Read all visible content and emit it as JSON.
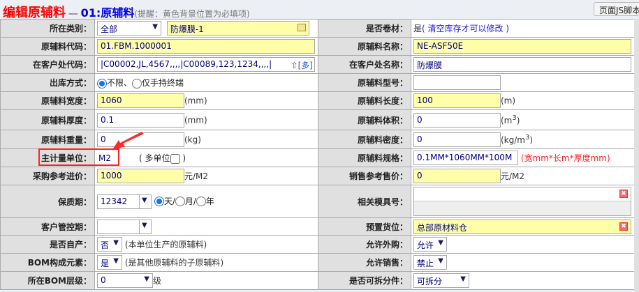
{
  "header": {
    "title": "编辑原辅料",
    "dash": "—",
    "subtitle": "01:原辅料",
    "hint": "(提醒：黄色背景位置为必填项)",
    "js_button": "页面JS脚本"
  },
  "colors": {
    "required": "#ffffaa",
    "title": "#ff0000",
    "subtitle": "#0000ee",
    "annotation": "#ff2222"
  },
  "fields": {
    "category": {
      "label": "所在类别：",
      "select": "全部",
      "value": "防爆膜-1"
    },
    "is_roll": {
      "label": "是否卷材：",
      "value": "是",
      "note": "( 清空库存才可以修改 )"
    },
    "code": {
      "label": "原辅料代码：",
      "value": "01.FBM.1000001"
    },
    "name": {
      "label": "原辅料名称：",
      "value": "NE-ASF50E"
    },
    "cust_code": {
      "label": "在客户处代码：",
      "value": "|C00002,JL,4567,,,,|C00089,123,1234,,,,|",
      "more": "[多]"
    },
    "cust_name": {
      "label": "在客户处名称：",
      "value": "防爆膜"
    },
    "outbound": {
      "label": "出库方式：",
      "opt1": "不限、",
      "opt2": "仅手持终端"
    },
    "model": {
      "label": "原辅料型号：",
      "value": ""
    },
    "width": {
      "label": "原辅料宽度：",
      "value": "1060",
      "unit": "(mm)"
    },
    "length": {
      "label": "原辅料长度：",
      "value": "100",
      "unit": "(m)"
    },
    "thickness": {
      "label": "原辅料厚度：",
      "value": "0.1",
      "unit": "(mm)"
    },
    "volume": {
      "label": "原辅料体积：",
      "value": "0",
      "unit": "(m",
      "sup": "3",
      "unit_end": ")"
    },
    "weight": {
      "label": "原辅料重量：",
      "value": "0",
      "unit": "(kg)"
    },
    "density": {
      "label": "原辅料密度：",
      "value": "0",
      "unit": "(kg/m",
      "sup": "3",
      "unit_end": ")"
    },
    "main_unit": {
      "label": "主计量单位：",
      "value": "M2",
      "multi": "( 多单位",
      "multi_end": ")"
    },
    "spec": {
      "label": "原辅料规格：",
      "value": "0.1MM*1060MM*100M",
      "note": "(宽mm*长m*厚度mm)"
    },
    "purchase_price": {
      "label": "采购参考进价：",
      "value": "1000",
      "unit": "元/M2"
    },
    "sale_price": {
      "label": "销售参考售价：",
      "value": "0",
      "unit": "元/M2"
    },
    "shelf_life": {
      "label": "保质期：",
      "value": "12342",
      "opt1": "天/",
      "opt2": "月/",
      "opt3": "年"
    },
    "mold": {
      "label": "相关模具号：",
      "value": ""
    },
    "cust_ctrl": {
      "label": "客户管控期：",
      "value": ""
    },
    "location": {
      "label": "预置货位：",
      "value": "总部原材料仓"
    },
    "self_made": {
      "label": "是否自产：",
      "value": "否",
      "note": "(本单位生产的原辅料)"
    },
    "allow_buy": {
      "label": "允许外购：",
      "value": "允许"
    },
    "bom_elem": {
      "label": "BOM构成元素：",
      "value": "是",
      "note": "(是其他原辅料的子原辅料)"
    },
    "allow_sale": {
      "label": "允许销售：",
      "value": "禁止"
    },
    "bom_level": {
      "label": "所在BOM层级：",
      "value": "0",
      "unit": "级"
    },
    "splittable": {
      "label": "是否可拆分件：",
      "value": "可拆分"
    }
  }
}
